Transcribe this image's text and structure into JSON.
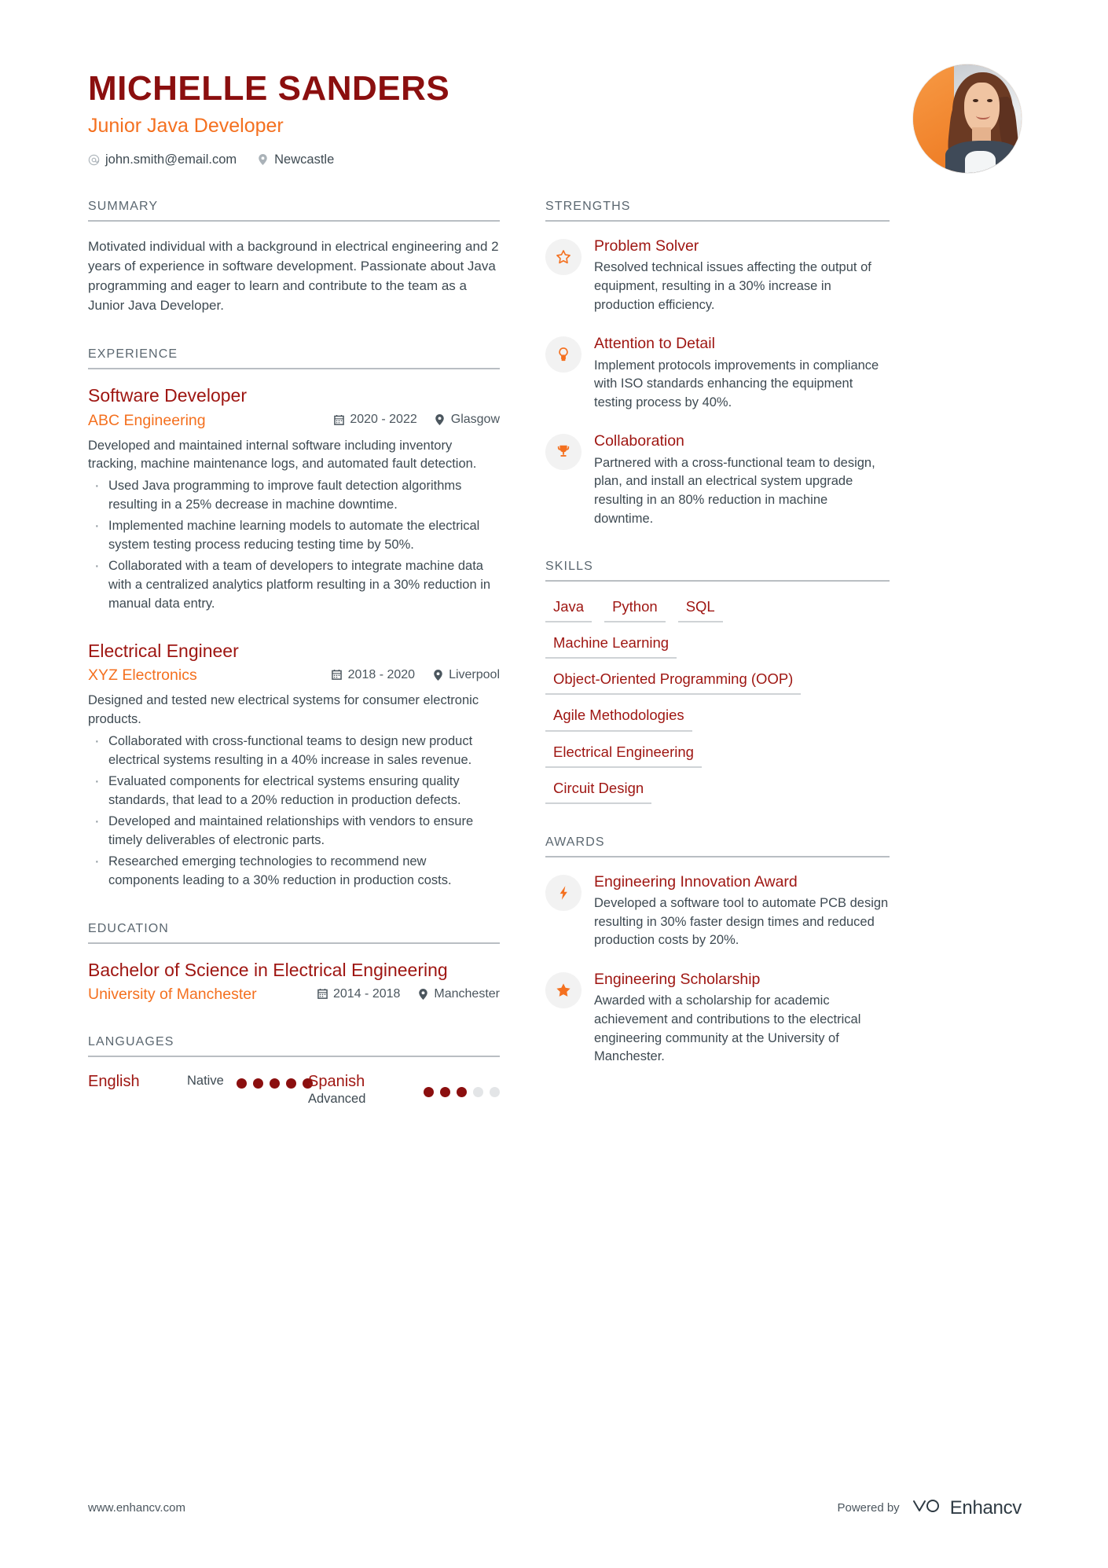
{
  "header": {
    "name": "MICHELLE SANDERS",
    "job_title": "Junior Java Developer",
    "email": "john.smith@email.com",
    "location": "Newcastle",
    "email_icon": "at-icon",
    "location_icon": "map-pin-icon",
    "avatar_alt": "profile-photo"
  },
  "colors": {
    "primary_dark_red": "#8B0F0F",
    "title_red": "#9E1511",
    "accent_orange": "#F4701F",
    "body_gray": "#3E4A52",
    "heading_gray": "#5B6770",
    "rule_gray": "#B9BEC3",
    "dot_off": "#E3E5E7"
  },
  "sections": {
    "summary_heading": "SUMMARY",
    "experience_heading": "EXPERIENCE",
    "education_heading": "EDUCATION",
    "languages_heading": "LANGUAGES",
    "strengths_heading": "STRENGTHS",
    "skills_heading": "SKILLS",
    "awards_heading": "AWARDS"
  },
  "summary": {
    "text": "Motivated individual with a background in electrical engineering and 2 years of experience in software development. Passionate about Java programming and eager to learn and contribute to the team as a Junior Java Developer."
  },
  "experience": [
    {
      "title": "Software Developer",
      "company": "ABC Engineering",
      "dates": "2020 - 2022",
      "location": "Glasgow",
      "description": "Developed and maintained internal software including inventory tracking, machine maintenance logs, and automated fault detection.",
      "bullets": [
        "Used Java programming to improve fault detection algorithms resulting in a 25% decrease in machine downtime.",
        "Implemented machine learning models to automate the electrical system testing process reducing testing time by 50%.",
        "Collaborated with a team of developers to integrate machine data with a centralized analytics platform resulting in a 30% reduction in manual data entry."
      ]
    },
    {
      "title": "Electrical Engineer",
      "company": "XYZ Electronics",
      "dates": "2018 - 2020",
      "location": "Liverpool",
      "description": "Designed and tested new electrical systems for consumer electronic products.",
      "bullets": [
        "Collaborated with cross-functional teams to design new product electrical systems resulting in a 40% increase in sales revenue.",
        "Evaluated components for electrical systems ensuring quality standards, that lead to a 20% reduction in production defects.",
        "Developed and maintained relationships with vendors to ensure timely deliverables of electronic parts.",
        "Researched emerging technologies to recommend new components leading to a 30% reduction in production costs."
      ]
    }
  ],
  "education": [
    {
      "degree": "Bachelor of Science in Electrical Engineering",
      "school": "University of Manchester",
      "dates": "2014 - 2018",
      "location": "Manchester"
    }
  ],
  "languages": [
    {
      "name": "English",
      "level": "Native",
      "filled": 5,
      "total": 5
    },
    {
      "name": "Spanish",
      "level": "Advanced",
      "filled": 3,
      "total": 5
    }
  ],
  "strengths": [
    {
      "icon": "star-icon",
      "title": "Problem Solver",
      "desc": "Resolved technical issues affecting the output of equipment, resulting in a 30% increase in production efficiency."
    },
    {
      "icon": "lightbulb-icon",
      "title": "Attention to Detail",
      "desc": "Implement protocols improvements in compliance with ISO standards enhancing the equipment testing process by 40%."
    },
    {
      "icon": "trophy-icon",
      "title": "Collaboration",
      "desc": "Partnered with a cross-functional team to design, plan, and install an electrical system upgrade resulting in an 80% reduction in machine downtime."
    }
  ],
  "skills": [
    [
      "Java",
      "Python",
      "SQL"
    ],
    [
      "Machine Learning"
    ],
    [
      "Object-Oriented Programming (OOP)"
    ],
    [
      "Agile Methodologies"
    ],
    [
      "Electrical Engineering"
    ],
    [
      "Circuit Design"
    ]
  ],
  "awards": [
    {
      "icon": "lightning-bolt-icon",
      "title": "Engineering Innovation Award",
      "desc": "Developed a software tool to automate PCB design resulting in 30% faster design times and reduced production costs by 20%."
    },
    {
      "icon": "star-badge-icon",
      "title": "Engineering Scholarship",
      "desc": "Awarded with a scholarship for academic achievement and contributions to the electrical engineering community at the University of Manchester."
    }
  ],
  "footer": {
    "url": "www.enhancv.com",
    "powered_by": "Powered by",
    "brand": "Enhancv",
    "brand_logo_icon": "enhancv-logo-icon"
  }
}
